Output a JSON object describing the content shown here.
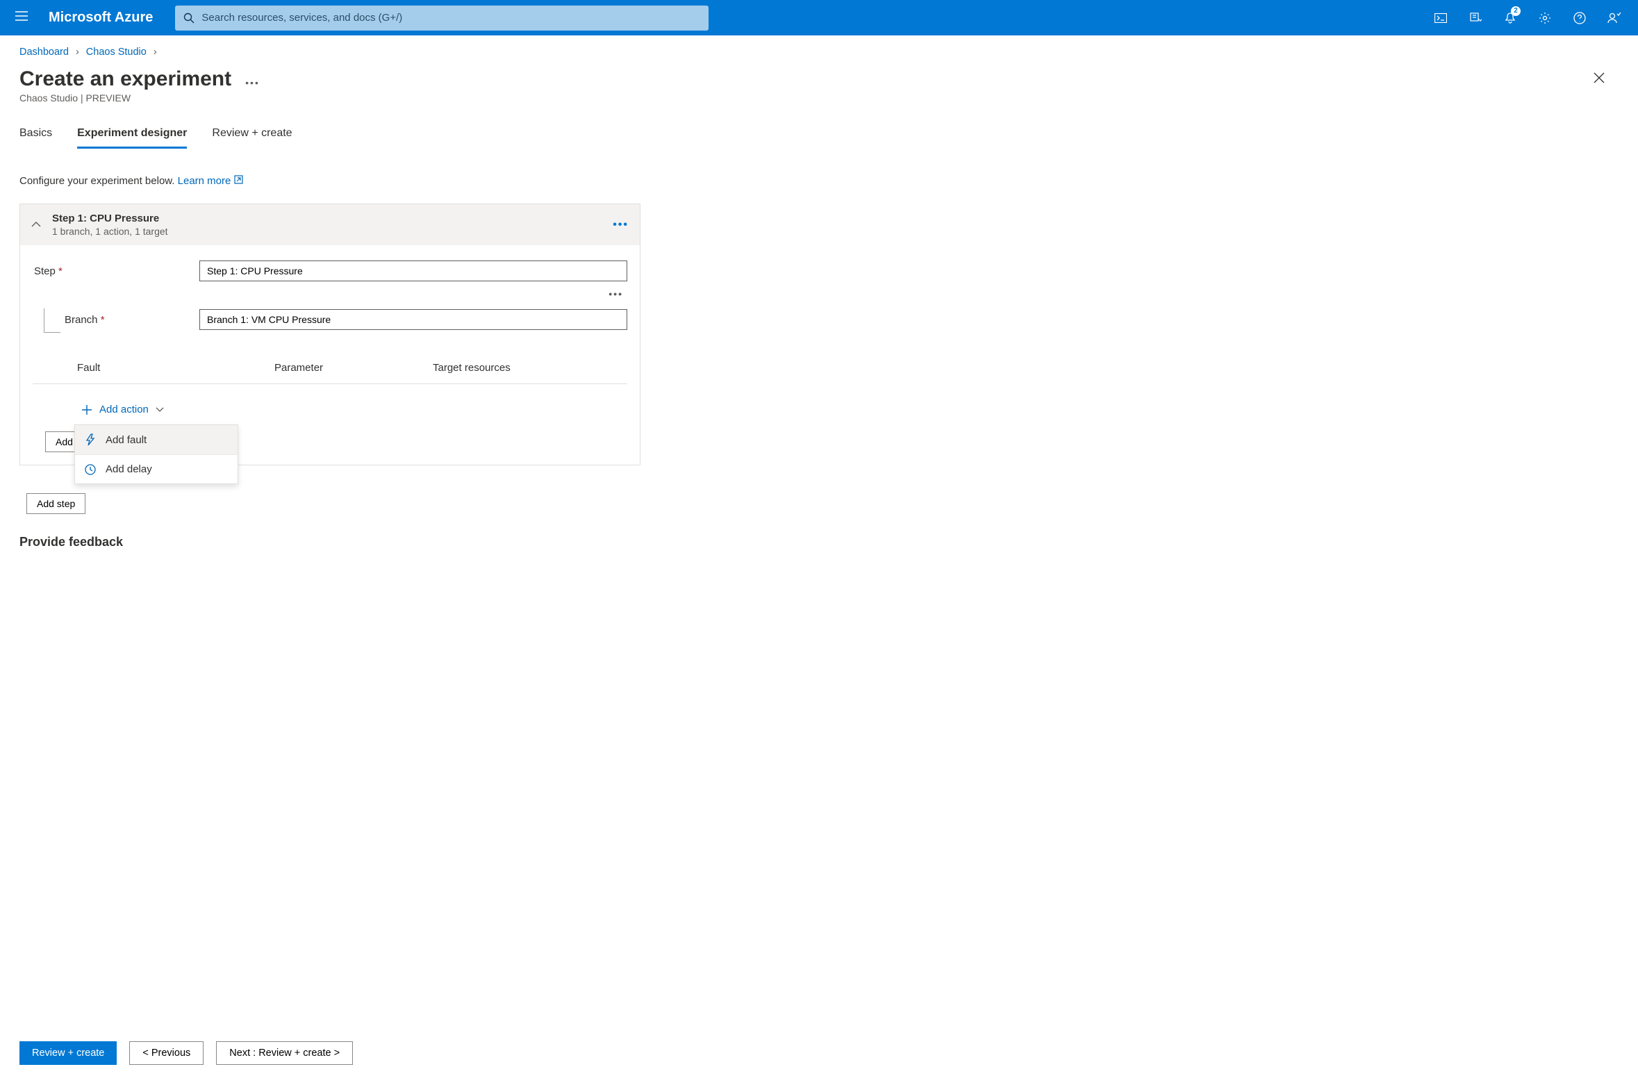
{
  "topbar": {
    "brand": "Microsoft Azure",
    "search_placeholder": "Search resources, services, and docs (G+/)",
    "notification_count": "2"
  },
  "breadcrumb": {
    "items": [
      "Dashboard",
      "Chaos Studio"
    ]
  },
  "page": {
    "title": "Create an experiment",
    "subtitle": "Chaos Studio | PREVIEW"
  },
  "tabs": {
    "items": [
      "Basics",
      "Experiment designer",
      "Review + create"
    ],
    "active_index": 1
  },
  "config": {
    "text": "Configure your experiment below.",
    "learn_more": "Learn more"
  },
  "step": {
    "title": "Step 1: CPU Pressure",
    "subtitle": "1 branch, 1 action, 1 target",
    "step_label": "Step",
    "step_value": "Step 1: CPU Pressure",
    "branch_label": "Branch",
    "branch_value": "Branch 1: VM CPU Pressure",
    "table_headers": {
      "fault": "Fault",
      "parameter": "Parameter",
      "target": "Target resources"
    },
    "add_action": "Add action",
    "dropdown": {
      "fault": "Add fault",
      "delay": "Add delay"
    },
    "add_branch": "Add",
    "add_step": "Add step"
  },
  "feedback": {
    "heading": "Provide feedback"
  },
  "footer": {
    "review": "Review + create",
    "previous": "< Previous",
    "next": "Next : Review + create >"
  }
}
